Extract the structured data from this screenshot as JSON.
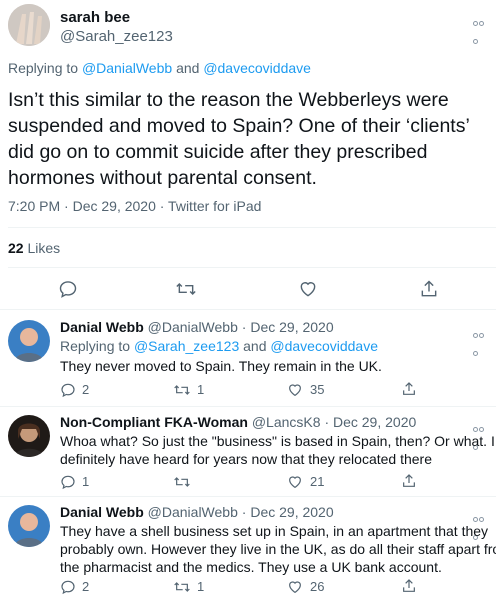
{
  "main_tweet": {
    "name": "sarah bee",
    "handle": "@Sarah_zee123",
    "replying_prefix": "Replying to",
    "replying_to_1": "@DanialWebb",
    "replying_and": "and",
    "replying_to_2": "@davecoviddave",
    "text": "Isn’t this similar to the reason the Webberleys were suspended and moved to Spain? One of their ‘clients’ did go on to commit suicide after they prescribed hormones without parental consent.",
    "timestamp": "7:20 PM · Dec 29, 2020 · Twitter for iPad",
    "likes_count": "22",
    "likes_label": "Likes",
    "actions": [
      "reply-icon",
      "retweet-icon",
      "like-icon",
      "share-icon"
    ]
  },
  "replies": [
    {
      "name": "Danial Webb",
      "handle": "@DanialWebb",
      "date": "· Dec 29, 2020",
      "replying_prefix": "Replying to",
      "replying_to_1": "@Sarah_zee123",
      "replying_and": "and",
      "replying_to_2": "@davecoviddave",
      "text": "They never moved to Spain. They remain in the UK.",
      "reply_count": "2",
      "retweet_count": "1",
      "like_count": "35"
    },
    {
      "name": "Non-Compliant FKA-Woman",
      "handle": "@LancsK8",
      "date": "· Dec 29, 2020",
      "text_line1": "Whoa what? So just the \"business\" is based in Spain, then? Or what. I",
      "text_line2": "definitely have heard for years now that they relocated there",
      "reply_count": "1",
      "retweet_count": "",
      "like_count": "21"
    },
    {
      "name": "Danial Webb",
      "handle": "@DanialWebb",
      "date": "· Dec 29, 2020",
      "text_line1": "They have a shell business set up in Spain, in an apartment that they",
      "text_line2": "probably own. However they live in the UK, as do all their staff apart from",
      "text_line3": "the pharmacist and the medics. They use a UK bank account.",
      "reply_count": "2",
      "retweet_count": "1",
      "like_count": "26"
    }
  ],
  "colors": {
    "link": "#1d9bf0",
    "muted": "#536471",
    "text": "#0f1419"
  }
}
